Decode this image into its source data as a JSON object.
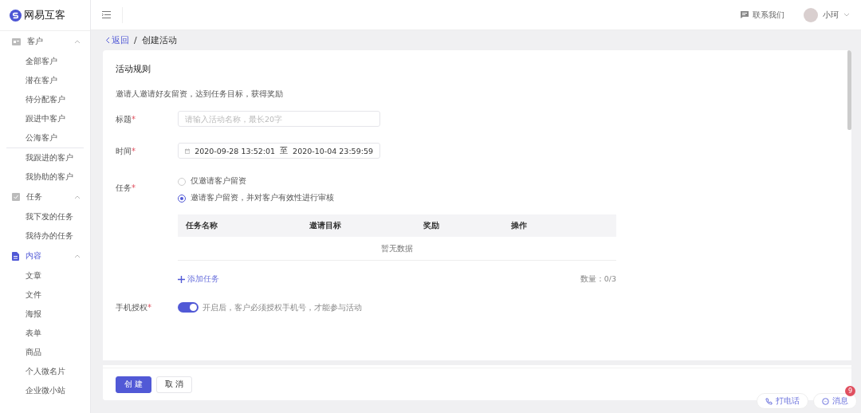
{
  "brand": {
    "name": "网易互客"
  },
  "header": {
    "contact": "联系我们",
    "user": "小珂"
  },
  "sidebar": {
    "groups": [
      {
        "label": "客户",
        "expanded": true,
        "selected": false,
        "sections": [
          [
            "全部客户",
            "潜在客户",
            "待分配客户",
            "跟进中客户",
            "公海客户"
          ],
          [
            "我跟进的客户",
            "我协助的客户"
          ]
        ]
      },
      {
        "label": "任务",
        "expanded": true,
        "selected": false,
        "sections": [
          [
            "我下发的任务",
            "我待办的任务"
          ]
        ]
      },
      {
        "label": "内容",
        "expanded": true,
        "selected": true,
        "sections": [
          [
            "文章",
            "文件",
            "海报",
            "表单",
            "商品",
            "个人微名片",
            "企业微小站"
          ]
        ]
      }
    ]
  },
  "breadcrumb": {
    "back": "返回",
    "separator": "/",
    "current": "创建活动"
  },
  "form": {
    "title": "活动规则",
    "description": "邀请人邀请好友留资，达到任务目标，获得奖励",
    "title_field": {
      "label": "标题",
      "required_mark": "*",
      "placeholder": "请输入活动名称，最长20字"
    },
    "time_field": {
      "label": "时间",
      "required_mark": "*",
      "start": "2020-09-28 13:52:01",
      "separator": "至",
      "end": "2020-10-04 23:59:59"
    },
    "task_field": {
      "label": "任务",
      "required_mark": "*",
      "options": [
        {
          "label": "仅邀请客户留资",
          "selected": false
        },
        {
          "label": "邀请客户留资，并对客户有效性进行审核",
          "selected": true
        }
      ]
    },
    "table": {
      "columns": [
        "任务名称",
        "邀请目标",
        "奖励",
        "操作"
      ],
      "empty": "暂无数据"
    },
    "add_task": "添加任务",
    "count": "数量：0/3",
    "phone_auth": {
      "label": "手机授权",
      "required_mark": "*",
      "on": true,
      "hint": "开启后，客户必须授权手机号，才能参与活动"
    }
  },
  "footer": {
    "buttons": [
      {
        "label": "创 建",
        "kind": "primary"
      },
      {
        "label": "取 消",
        "kind": "default"
      }
    ]
  },
  "float": {
    "call": "打电话",
    "message": "消息",
    "badge": "9"
  }
}
